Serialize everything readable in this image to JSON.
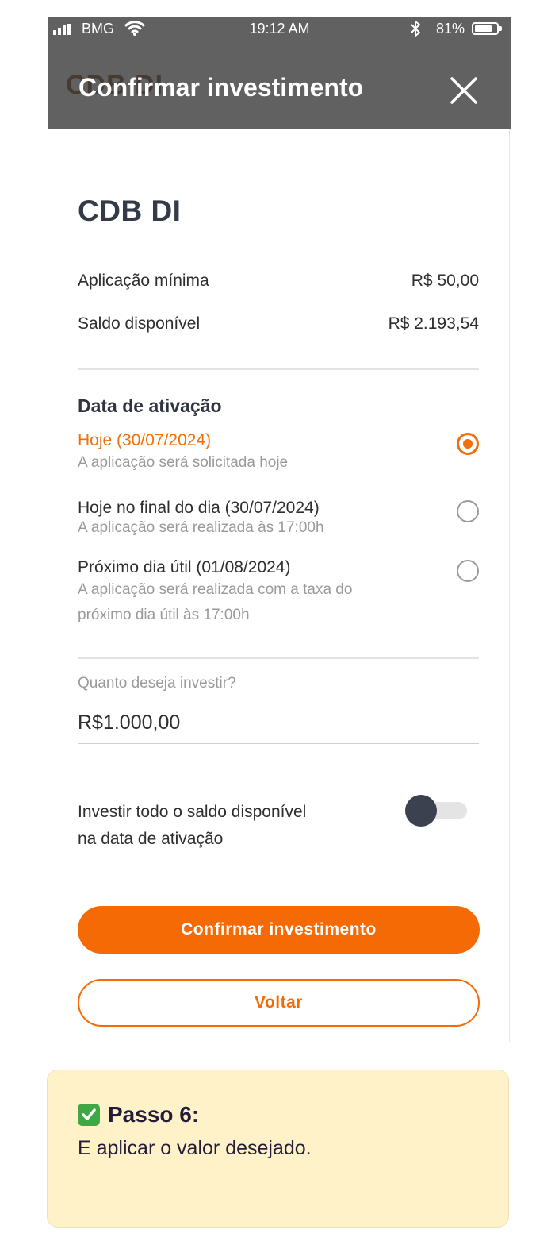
{
  "status_bar": {
    "carrier": "BMG",
    "time": "19:12 AM",
    "battery_percent": "81%",
    "battery_level": 0.81,
    "icons": [
      "signal-icon",
      "wifi-icon",
      "bluetooth-icon",
      "battery-icon"
    ]
  },
  "header": {
    "ghost_title": "CDB DI",
    "title": "Confirmar investimento",
    "close_icon": "close-icon"
  },
  "product": {
    "name": "CDB DI",
    "min_label": "Aplicação mínima",
    "min_value": "R$ 50,00",
    "balance_label": "Saldo disponível",
    "balance_value": "R$ 2.193,54"
  },
  "activation": {
    "title": "Data de ativação",
    "options": [
      {
        "label": "Hoje (30/07/2024)",
        "desc": "A aplicação será solicitada hoje",
        "selected": true
      },
      {
        "label": "Hoje no final do dia (30/07/2024)",
        "desc": "A aplicação será realizada às 17:00h",
        "selected": false
      },
      {
        "label": "Próximo dia útil (01/08/2024)",
        "desc_line1": "A aplicação será realizada com a taxa do",
        "desc_line2": "próximo dia útil às 17:00h",
        "selected": false
      }
    ]
  },
  "amount": {
    "label": "Quanto deseja investir?",
    "value": "R$1.000,00"
  },
  "toggle": {
    "line1": "Investir todo o saldo disponível",
    "line2": "na data de ativação",
    "on": false
  },
  "buttons": {
    "confirm": "Confirmar investimento",
    "back": "Voltar"
  },
  "note": {
    "step": "Passo 6:",
    "text": "E aplicar o valor desejado.",
    "icon": "check-icon"
  },
  "colors": {
    "accent": "#f66a05",
    "header_bg": "#616161",
    "note_bg": "#fff2c9",
    "check": "#3fa845"
  }
}
